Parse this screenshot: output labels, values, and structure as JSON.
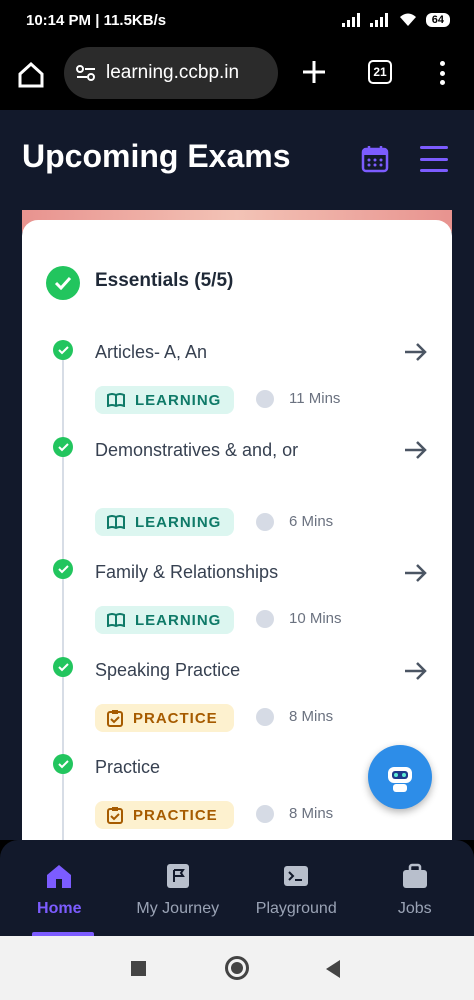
{
  "status_bar": {
    "time_speed": "10:14 PM | 11.5KB/s",
    "battery": "64"
  },
  "browser": {
    "url": "learning.ccbp.in",
    "tab_count": "21"
  },
  "header": {
    "title": "Upcoming Exams"
  },
  "section": {
    "title": "Essentials (5/5)"
  },
  "items": [
    {
      "title": "Articles- A, An",
      "badge": "LEARNING",
      "duration": "11 Mins",
      "has_arrow": true
    },
    {
      "title": "Demonstratives & and, or",
      "badge": "LEARNING",
      "duration": "6 Mins",
      "has_arrow": true
    },
    {
      "title": "Family & Relationships",
      "badge": "LEARNING",
      "duration": "10 Mins",
      "has_arrow": true
    },
    {
      "title": "Speaking Practice",
      "badge": "PRACTICE",
      "duration": "8 Mins",
      "has_arrow": true
    },
    {
      "title": "Practice",
      "badge": "PRACTICE",
      "duration": "8 Mins",
      "has_arrow": false
    }
  ],
  "bottom_nav": [
    {
      "label": "Home",
      "icon": "home-icon",
      "active": true
    },
    {
      "label": "My Journey",
      "icon": "flag-icon",
      "active": false
    },
    {
      "label": "Playground",
      "icon": "terminal-icon",
      "active": false
    },
    {
      "label": "Jobs",
      "icon": "briefcase-icon",
      "active": false
    }
  ],
  "colors": {
    "header_bg": "#12192b",
    "accent": "#7c5cff",
    "success": "#22c55e",
    "learning_bg": "#dcf6f0",
    "practice_bg": "#fdf1cf"
  }
}
